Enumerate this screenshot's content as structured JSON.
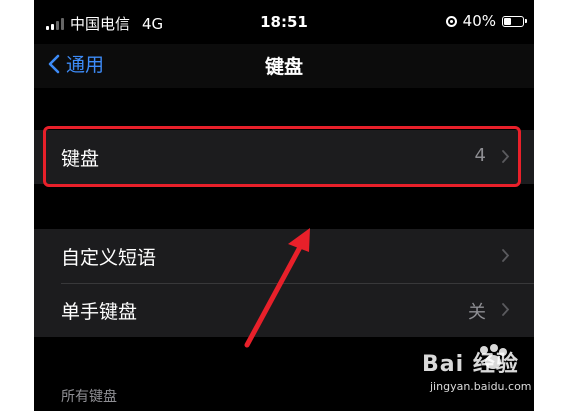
{
  "status_bar": {
    "carrier": "中国电信",
    "network": "4G",
    "time": "18:51",
    "battery": "40%"
  },
  "nav": {
    "back_label": "通用",
    "title": "键盘"
  },
  "keyboard_row": {
    "label": "键盘",
    "count": "4"
  },
  "settings": [
    {
      "label": "自定义短语",
      "value": ""
    },
    {
      "label": "单手键盘",
      "value": "关"
    }
  ],
  "section_header": "所有键盘",
  "watermark": {
    "brand": "Bai 经验",
    "url": "jingyan.baidu.com"
  },
  "colors": {
    "accent": "#3d8bf7",
    "highlight": "#e8202a",
    "arrow": "#e8202a"
  }
}
